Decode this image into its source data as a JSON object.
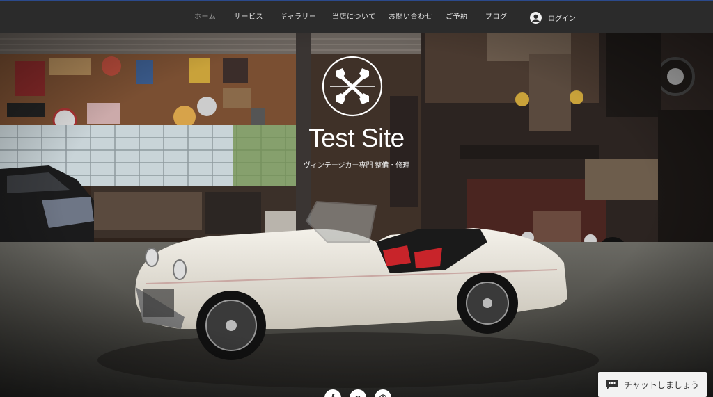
{
  "nav": {
    "items": [
      {
        "label": "ホーム",
        "active": true
      },
      {
        "label": "サービス",
        "active": false
      },
      {
        "label": "ギャラリー",
        "active": false
      },
      {
        "label": "当店について",
        "active": false
      },
      {
        "label": "お問い合わせ",
        "active": false
      },
      {
        "label": "ご予約",
        "active": false
      },
      {
        "label": "ブログ",
        "active": false
      }
    ],
    "login_label": "ログイン"
  },
  "hero": {
    "site_title": "Test Site",
    "subtitle": "ヴィンテージカー専門 整備・修理",
    "logo_icon": "crossed-wrenches-icon"
  },
  "social": [
    {
      "icon": "facebook-icon",
      "glyph": "f"
    },
    {
      "icon": "pinterest-icon",
      "glyph": "p"
    },
    {
      "icon": "instagram-icon",
      "glyph": "◎"
    }
  ],
  "chat": {
    "label": "チャットしましょう",
    "icon": "chat-bubble-icon"
  },
  "colors": {
    "navbar_bg": "#2b2b2b",
    "top_accent": "#2b4a8c",
    "nav_text": "#e6e6e6",
    "nav_active": "#9a9a9a"
  }
}
